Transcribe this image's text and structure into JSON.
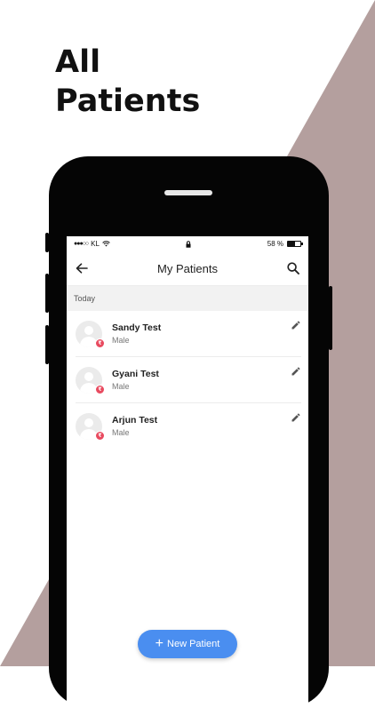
{
  "promo": {
    "title_line1": "All",
    "title_line2": "Patients"
  },
  "colors": {
    "background_triangle": "#b49f9e",
    "fab": "#4a8ef0",
    "badge": "#e84a5f"
  },
  "status_bar": {
    "carrier": "KL",
    "battery_text": "58 %",
    "battery_level_percent": 58
  },
  "app_bar": {
    "title": "My Patients",
    "back_icon": "arrow-left-icon",
    "search_icon": "search-icon"
  },
  "section": {
    "label": "Today"
  },
  "patients": [
    {
      "name": "Sandy Test",
      "gender": "Male",
      "badge": "₹"
    },
    {
      "name": "Gyani Test",
      "gender": "Male",
      "badge": "₹"
    },
    {
      "name": "Arjun Test",
      "gender": "Male",
      "badge": "₹"
    }
  ],
  "fab": {
    "icon": "+",
    "label": "New Patient"
  }
}
